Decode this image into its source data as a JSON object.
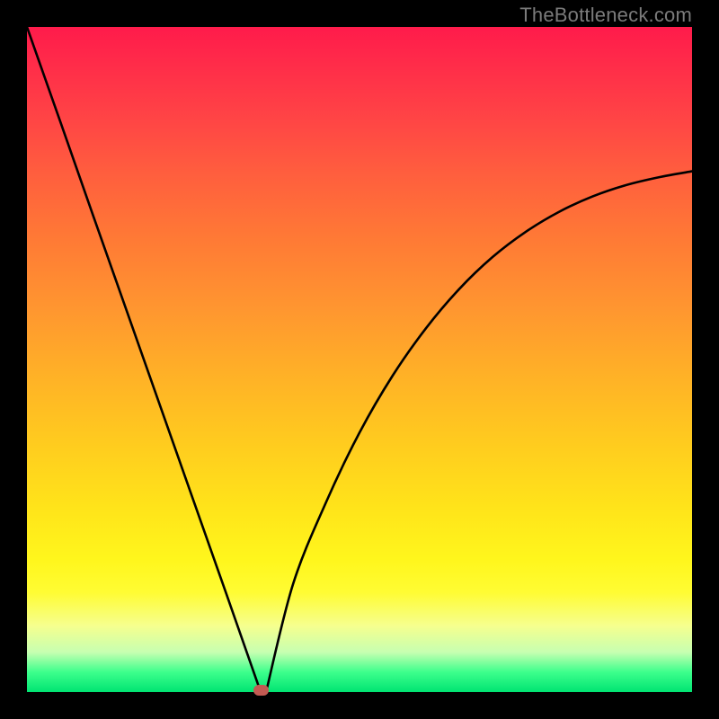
{
  "watermark": "TheBottleneck.com",
  "chart_data": {
    "type": "line",
    "title": "",
    "xlabel": "",
    "ylabel": "",
    "xlim": [
      0,
      1
    ],
    "ylim": [
      0,
      1
    ],
    "x": [
      0.0,
      0.05,
      0.1,
      0.15,
      0.2,
      0.25,
      0.3,
      0.3514,
      0.4,
      0.45,
      0.5,
      0.55,
      0.6,
      0.65,
      0.7,
      0.75,
      0.8,
      0.85,
      0.9,
      0.95,
      1.0
    ],
    "y": [
      1.0,
      0.858,
      0.715,
      0.573,
      0.431,
      0.289,
      0.147,
      0.0,
      0.162,
      0.286,
      0.39,
      0.476,
      0.547,
      0.606,
      0.654,
      0.692,
      0.722,
      0.745,
      0.762,
      0.774,
      0.783
    ],
    "minimum_x": 0.3514,
    "background_gradient": {
      "top": "#ff1b4b",
      "middle": "#ffe31a",
      "bottom": "#00e472"
    },
    "marker": {
      "x": 0.3514,
      "y": 0.0,
      "color": "#c25a52"
    }
  }
}
